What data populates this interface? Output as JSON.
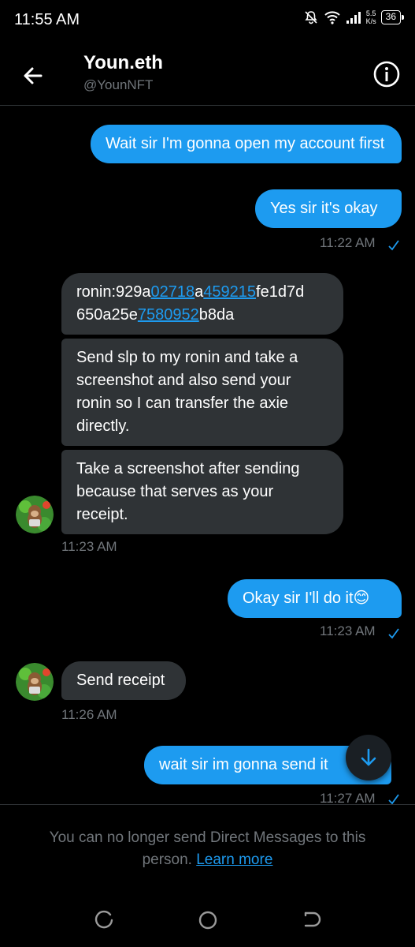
{
  "status": {
    "time": "11:55 AM",
    "net_speed_value": "5.5",
    "net_speed_unit": "K/s",
    "battery": "36"
  },
  "header": {
    "name": "Youn.eth",
    "handle": "@YounNFT"
  },
  "messages": {
    "m1": "Wait sir I'm gonna open my account first",
    "m2": "Yes sir it's okay",
    "t1": "11:22 AM",
    "m3": {
      "p1": "ronin:929a",
      "l1": "02718",
      "p2": "a",
      "l2": "459215",
      "p3": "fe1d7d 650a25e",
      "l3": "7580952",
      "p4": "b8da"
    },
    "m4": "Send slp to my ronin and take a screenshot and also send your ronin so I can transfer the axie directly.",
    "m5": "Take a screenshot after sending because that serves as your receipt.",
    "t2": "11:23 AM",
    "m6": "Okay sir I'll do it😊",
    "t3": "11:23 AM",
    "m7": "Send receipt",
    "t4": "11:26 AM",
    "m8": "wait sir im gonna send it",
    "t5": "11:27 AM"
  },
  "footer": {
    "notice": "You can no longer send Direct Messages to this person.",
    "link": "Learn more"
  },
  "colors": {
    "accent": "#1d9bf0",
    "bubble_received": "#2f3336",
    "background": "#000000"
  }
}
